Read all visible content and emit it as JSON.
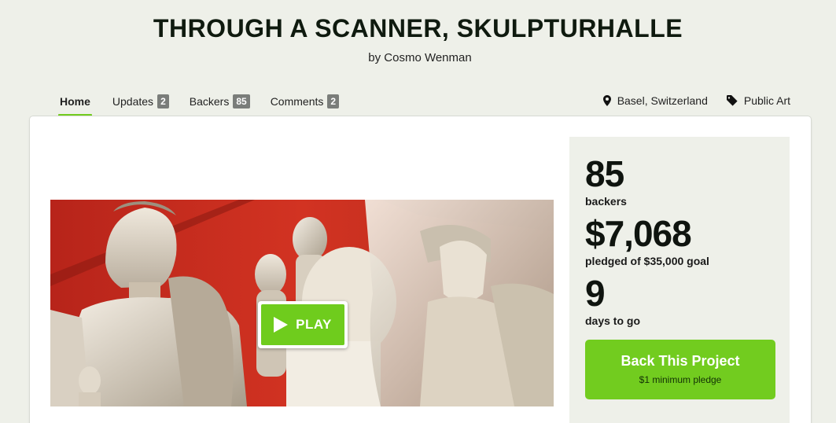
{
  "project": {
    "title": "THROUGH A SCANNER, SKULPTURHALLE",
    "byline": "by Cosmo Wenman"
  },
  "tabs": [
    {
      "label": "Home",
      "active": true
    },
    {
      "label": "Updates",
      "count": "2"
    },
    {
      "label": "Backers",
      "count": "85"
    },
    {
      "label": "Comments",
      "count": "2"
    }
  ],
  "meta": {
    "location": {
      "label": "Basel, Switzerland",
      "icon": "map-pin-icon"
    },
    "category": {
      "label": "Public Art",
      "icon": "tag-icon"
    }
  },
  "video": {
    "play_label": "PLAY",
    "play_icon": "play-icon"
  },
  "stats": {
    "backers": {
      "value": "85",
      "label": "backers"
    },
    "pledged": {
      "value": "$7,068",
      "label": "pledged of $35,000 goal"
    },
    "days": {
      "value": "9",
      "label": "days to go"
    }
  },
  "cta": {
    "label": "Back This Project",
    "sublabel": "$1 minimum pledge"
  },
  "colors": {
    "accent": "#72cc1f",
    "background": "#eef0e9",
    "badge": "#7a7d7a",
    "video_bg": "#c9271b"
  }
}
